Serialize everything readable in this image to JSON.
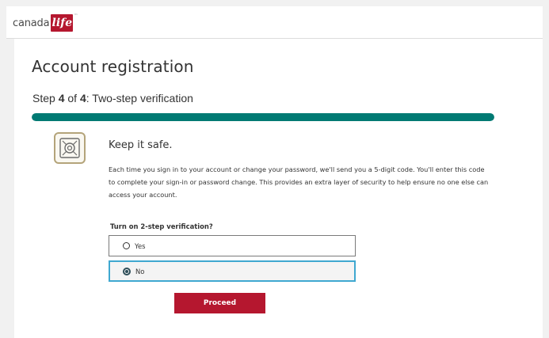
{
  "brand": {
    "name_text": "canada",
    "badge_text": "life",
    "trademark": "™",
    "accent_color": "#b5172f"
  },
  "page": {
    "title": "Account registration",
    "step_prefix": "Step ",
    "step_current": "4",
    "step_of": " of ",
    "step_total": "4",
    "step_suffix": ": Two-step verification",
    "progress_fraction": 1.0,
    "progress_color": "#007a73"
  },
  "info": {
    "icon": "safe-icon",
    "heading": "Keep it safe.",
    "body": "Each time you sign in to your account or change your password, we'll send you a 5-digit code. You'll enter this code to complete your sign-in or password change. This provides an extra layer of security to help ensure no one else can access your account."
  },
  "form": {
    "question": "Turn on 2-step verification?",
    "options": [
      {
        "label": "Yes",
        "selected": false
      },
      {
        "label": "No",
        "selected": true
      }
    ],
    "submit_label": "Proceed"
  }
}
